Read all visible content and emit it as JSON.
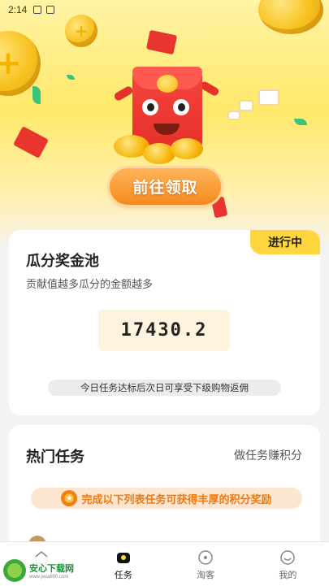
{
  "status_bar": {
    "time": "2:14"
  },
  "hero": {
    "cta_label": "前往领取"
  },
  "prize_pool": {
    "title": "瓜分奖金池",
    "subtitle": "贡献值越多瓜分的金额越多",
    "status_badge": "进行中",
    "amount": "17430.2",
    "notice": "今日任务达标后次日可享受下级购物返佣"
  },
  "hot_tasks": {
    "title": "热门任务",
    "more_link": "做任务赚积分",
    "banner": "完成以下列表任务可获得丰厚的积分奖励",
    "first_item_title": "…"
  },
  "tab_bar": {
    "tabs": [
      {
        "label": "",
        "icon": "home-icon"
      },
      {
        "label": "任务",
        "icon": "task-icon"
      },
      {
        "label": "淘客",
        "icon": "taoke-icon"
      },
      {
        "label": "我的",
        "icon": "profile-icon"
      }
    ]
  },
  "watermark": {
    "name": "安心下载网",
    "url": "www.java800.com"
  },
  "colors": {
    "accent_yellow": "#ffd640",
    "cta_orange": "#f58a1e",
    "banner_text": "#f07a12"
  }
}
